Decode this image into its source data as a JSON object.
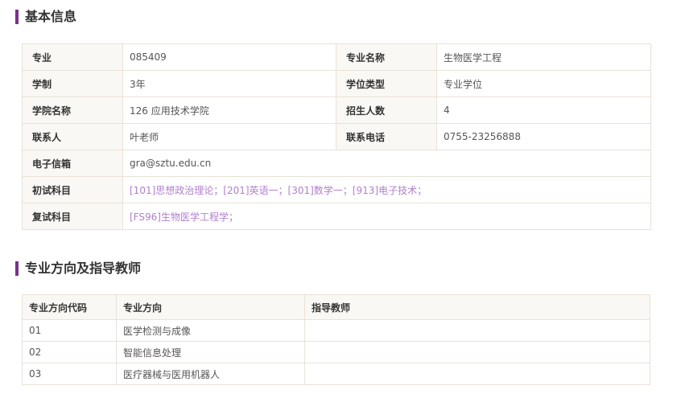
{
  "sections": {
    "basic_title": "基本信息",
    "direction_title": "专业方向及指导教师"
  },
  "basic": {
    "major_label": "专业",
    "major_value": "085409",
    "major_name_label": "专业名称",
    "major_name_value": "生物医学工程",
    "duration_label": "学制",
    "duration_value": "3年",
    "degree_type_label": "学位类型",
    "degree_type_value": "专业学位",
    "college_label": "学院名称",
    "college_value": "126 应用技术学院",
    "enroll_label": "招生人数",
    "enroll_value": "4",
    "contact_label": "联系人",
    "contact_value": "叶老师",
    "phone_label": "联系电话",
    "phone_value": "0755-23256888",
    "email_label": "电子信箱",
    "email_value": "gra@sztu.edu.cn",
    "initial_exam_label": "初试科目",
    "initial_exam_value": "[101]思想政治理论；[201]英语一；[301]数学一；[913]电子技术；",
    "retest_label": "复试科目",
    "retest_value": "[FS96]生物医学工程学；"
  },
  "directions": {
    "headers": [
      "专业方向代码",
      "专业方向",
      "指导教师"
    ],
    "rows": [
      [
        "01",
        "医学检测与成像",
        ""
      ],
      [
        "02",
        "智能信息处理",
        ""
      ],
      [
        "03",
        "医疗器械与医用机器人",
        ""
      ]
    ]
  },
  "colors": {
    "accent": "#7b2f8e",
    "link_purple": "#b07fcf",
    "label_bg": "#faf8f4",
    "border": "#e9e2d6"
  }
}
